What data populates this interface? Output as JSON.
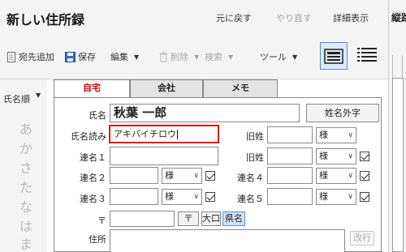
{
  "app": {
    "title": "新しい住所録"
  },
  "header_actions": {
    "undo": "元に戻す",
    "redo": "やり直す",
    "details": "詳細表示"
  },
  "toolbar": {
    "add_recipient": "宛先追加",
    "save": "保存",
    "edit": "編集",
    "delete": "削除",
    "search": "検索",
    "tools": "ツール"
  },
  "right_panel": {
    "title": "縦路"
  },
  "sidebar": {
    "sort_label": "氏名順",
    "kana_index": [
      "あ",
      "か",
      "さ",
      "た",
      "な",
      "は",
      "ま"
    ]
  },
  "tabs": [
    "自宅",
    "会社",
    "メモ"
  ],
  "form": {
    "name_label": "氏名",
    "name_value": "秋葉 一郎",
    "name_external_button": "姓名外字",
    "reading_label": "氏名読み",
    "reading_value": "アキバイチロウ",
    "old_surname_label": "旧姓",
    "title_value": "様",
    "joint1_label": "連名１",
    "joint2_label": "連名２",
    "joint3_label": "連名３",
    "joint4_label": "連名４",
    "joint5_label": "連名５",
    "postal_label": "〒",
    "postal_button": "〒",
    "oaza_button": "大口",
    "county_button": "県名",
    "address_label": "住所",
    "newline_button": "改行"
  },
  "colors": {
    "active_tab": "#d40000",
    "highlight_border": "#e01919",
    "accent": "#5b8fd0"
  }
}
